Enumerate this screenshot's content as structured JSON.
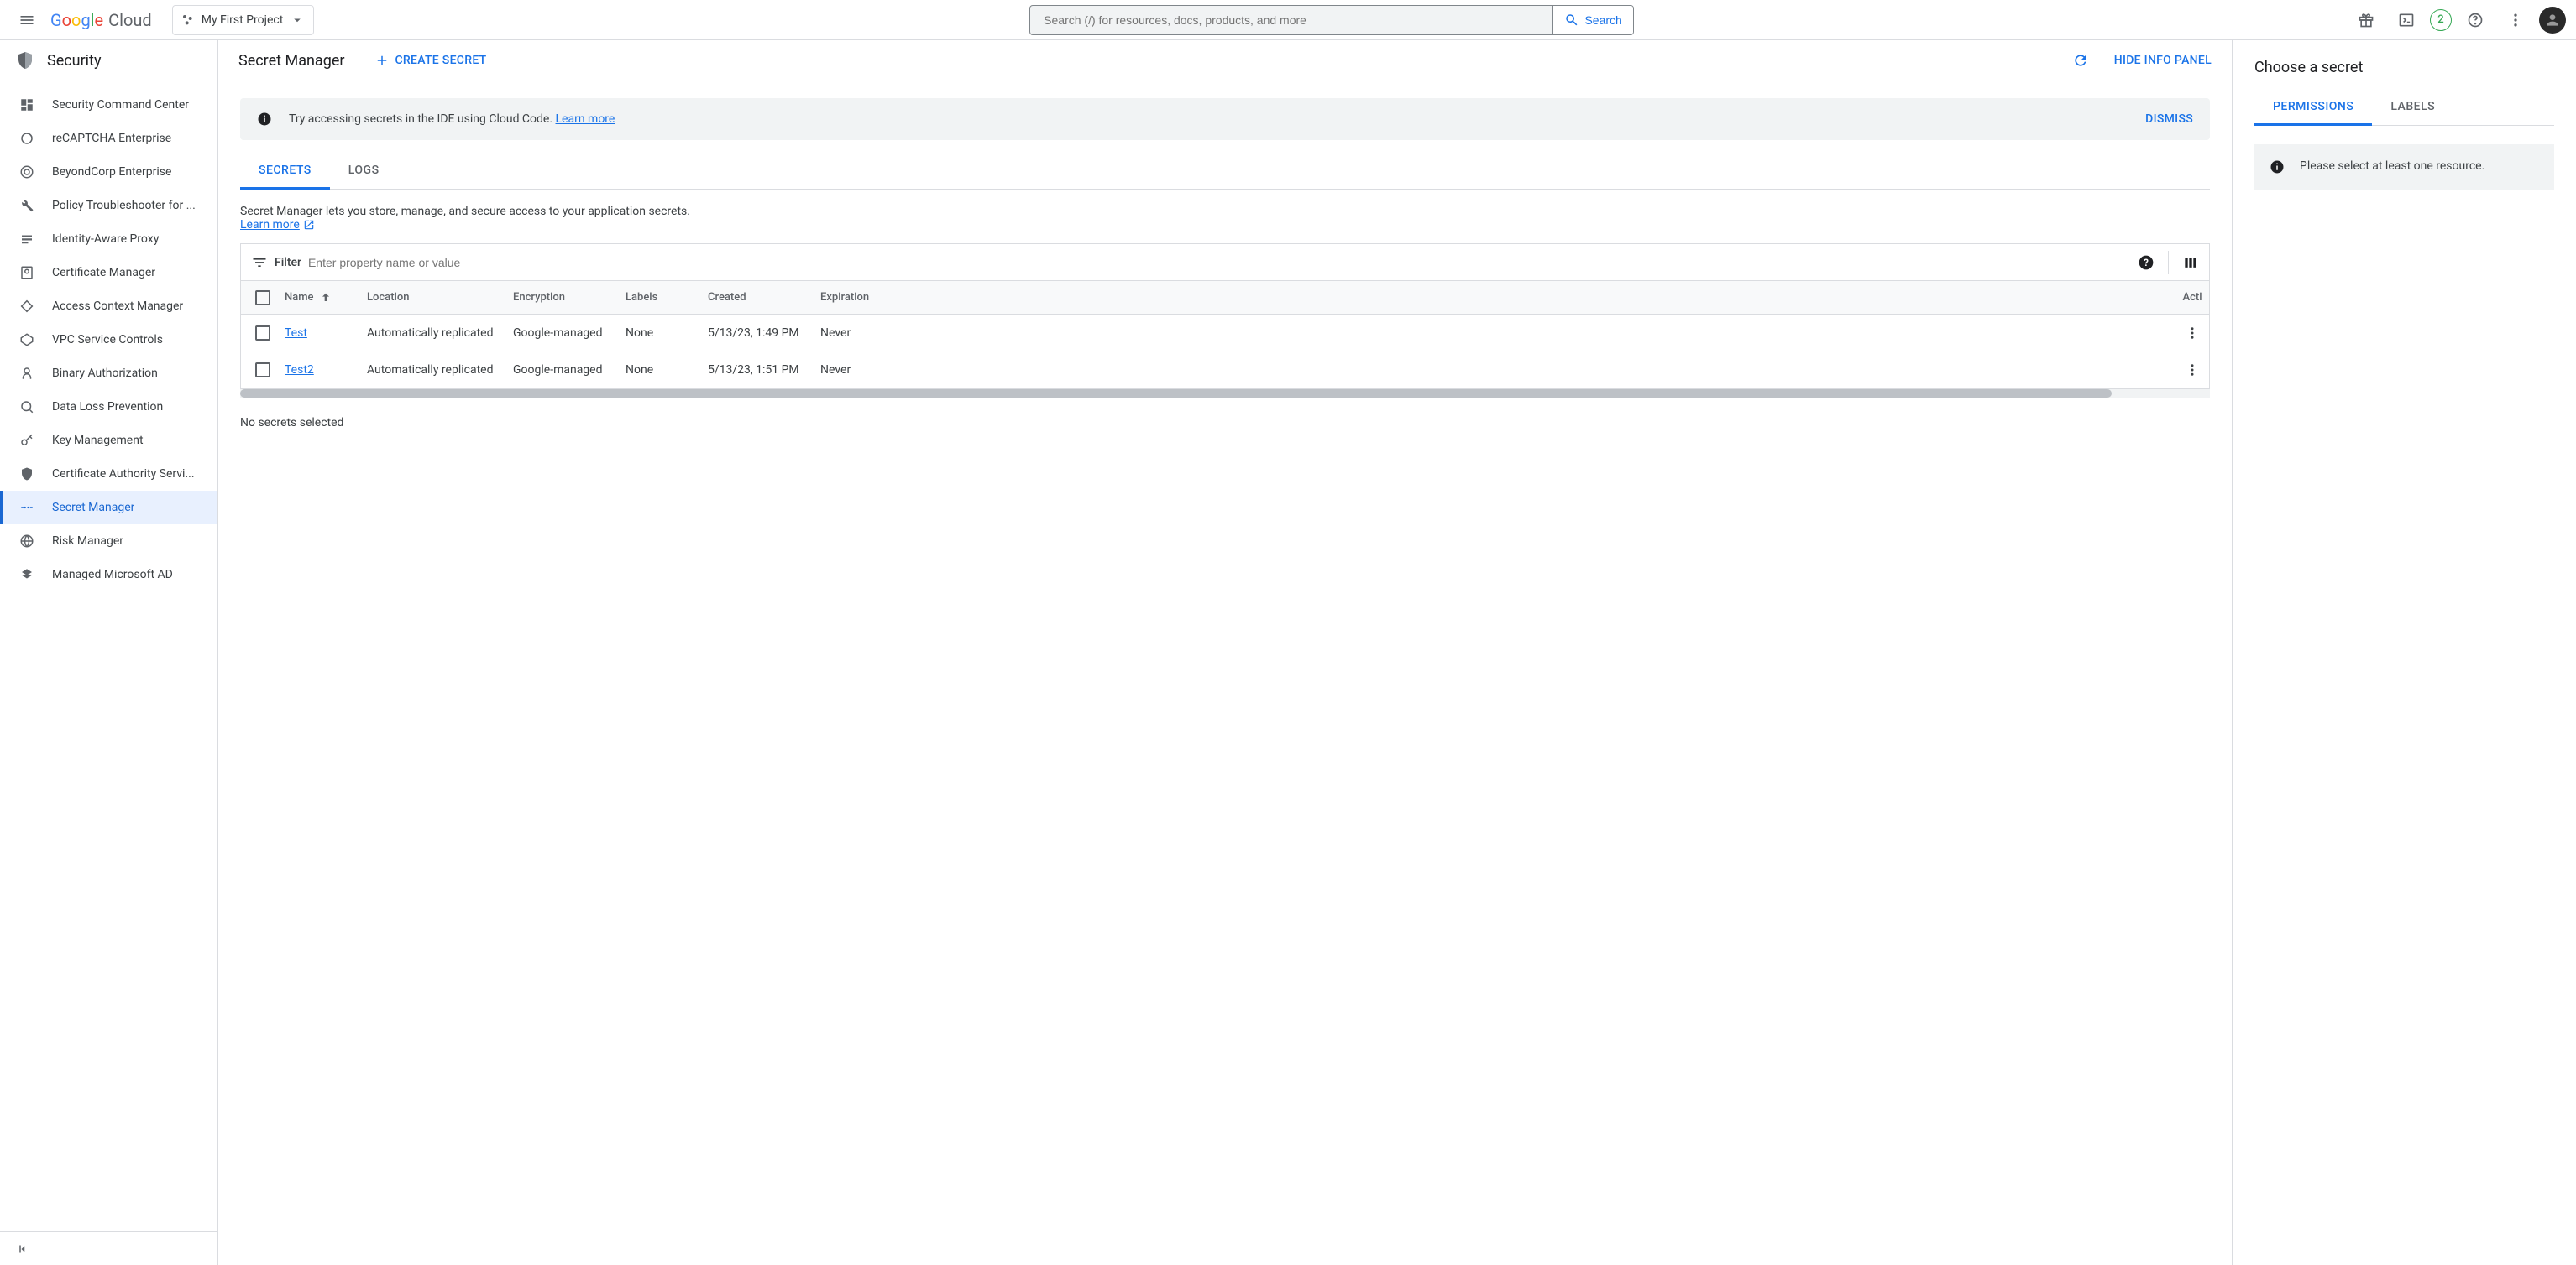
{
  "header": {
    "logo_text": "Google Cloud",
    "project_name": "My First Project",
    "search_placeholder": "Search (/) for resources, docs, products, and more",
    "search_button": "Search",
    "trial_count": "2"
  },
  "sidebar": {
    "title": "Security",
    "items": [
      {
        "label": "Security Command Center",
        "icon": "dashboard"
      },
      {
        "label": "reCAPTCHA Enterprise",
        "icon": "recaptcha"
      },
      {
        "label": "BeyondCorp Enterprise",
        "icon": "beyondcorp"
      },
      {
        "label": "Policy Troubleshooter for ...",
        "icon": "wrench"
      },
      {
        "label": "Identity-Aware Proxy",
        "icon": "iap"
      },
      {
        "label": "Certificate Manager",
        "icon": "cert"
      },
      {
        "label": "Access Context Manager",
        "icon": "diamond"
      },
      {
        "label": "VPC Service Controls",
        "icon": "vpc"
      },
      {
        "label": "Binary Authorization",
        "icon": "binauth"
      },
      {
        "label": "Data Loss Prevention",
        "icon": "dlp"
      },
      {
        "label": "Key Management",
        "icon": "key"
      },
      {
        "label": "Certificate Authority Servi...",
        "icon": "cas"
      },
      {
        "label": "Secret Manager",
        "icon": "secret",
        "active": true
      },
      {
        "label": "Risk Manager",
        "icon": "risk"
      },
      {
        "label": "Managed Microsoft AD",
        "icon": "msad"
      }
    ]
  },
  "main": {
    "title": "Secret Manager",
    "create_button": "CREATE SECRET",
    "hide_info": "HIDE INFO PANEL",
    "banner_text": "Try accessing secrets in the IDE using Cloud Code. ",
    "banner_link": "Learn more",
    "banner_dismiss": "DISMISS",
    "tabs": [
      {
        "label": "SECRETS",
        "active": true
      },
      {
        "label": "LOGS"
      }
    ],
    "description": "Secret Manager lets you store, manage, and secure access to your application secrets.",
    "learn_more": "Learn more",
    "filter_label": "Filter",
    "filter_placeholder": "Enter property name or value",
    "columns": [
      "Name",
      "Location",
      "Encryption",
      "Labels",
      "Created",
      "Expiration",
      "Acti"
    ],
    "rows": [
      {
        "name": "Test",
        "location": "Automatically replicated",
        "encryption": "Google-managed",
        "labels": "None",
        "created": "5/13/23, 1:49 PM",
        "expiration": "Never"
      },
      {
        "name": "Test2",
        "location": "Automatically replicated",
        "encryption": "Google-managed",
        "labels": "None",
        "created": "5/13/23, 1:51 PM",
        "expiration": "Never"
      }
    ],
    "selection_text": "No secrets selected"
  },
  "info_panel": {
    "title": "Choose a secret",
    "tabs": [
      {
        "label": "PERMISSIONS",
        "active": true
      },
      {
        "label": "LABELS"
      }
    ],
    "callout": "Please select at least one resource."
  }
}
